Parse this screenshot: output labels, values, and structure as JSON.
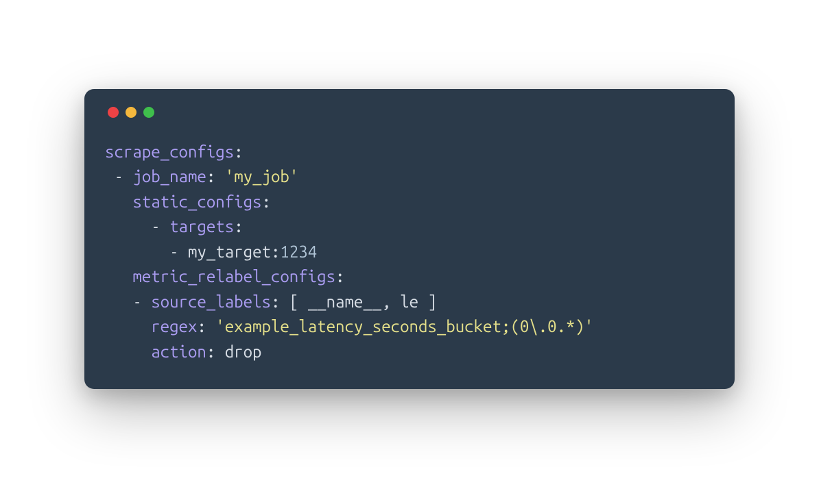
{
  "window": {
    "colors": {
      "bg": "#2b3a4a",
      "key": "#ab9df2",
      "string": "#e5e08a",
      "text": "#d9dfe7",
      "red": "#ed4245",
      "yellow": "#f5b83d",
      "green": "#3fbf4c"
    }
  },
  "code": {
    "l1": {
      "k1": "scrape_configs",
      "colon1": ":"
    },
    "l2": {
      "dash": " - ",
      "k1": "job_name",
      "colon": ": ",
      "v1": "'my_job'"
    },
    "l3": {
      "pad": "   ",
      "k1": "static_configs",
      "colon": ":"
    },
    "l4": {
      "pad": "     ",
      "dash": "- ",
      "k1": "targets",
      "colon": ":"
    },
    "l5": {
      "pad": "       ",
      "dash": "- ",
      "v1": "my_target:",
      "v2": "1234"
    },
    "l6": {
      "pad": "   ",
      "k1": "metric_relabel_configs",
      "colon": ":"
    },
    "l7": {
      "pad": "   ",
      "dash": "- ",
      "k1": "source_labels",
      "colon": ": ",
      "br1": "[ ",
      "v1": "__name__",
      "comma": ", ",
      "v2": "le",
      "br2": " ]"
    },
    "l8": {
      "pad": "     ",
      "k1": "regex",
      "colon": ": ",
      "v1": "'example_latency_seconds_bucket;(0\\.0.*)'"
    },
    "l9": {
      "pad": "     ",
      "k1": "action",
      "colon": ": ",
      "v1": "drop"
    }
  }
}
